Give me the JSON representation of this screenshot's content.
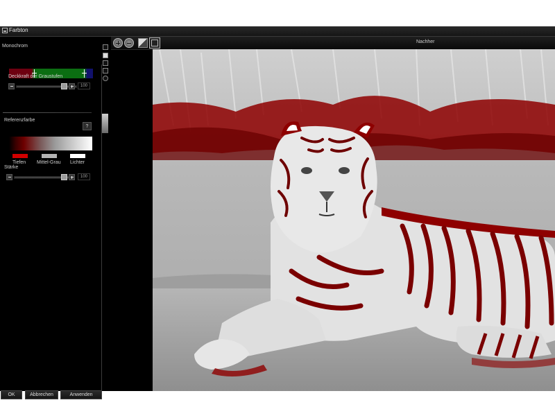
{
  "window": {
    "title": "Farbton"
  },
  "monochrom": {
    "section_label": "Monochrom",
    "opacity_label": "Deckkraft der Graustufen",
    "opacity_value": "100"
  },
  "reference": {
    "section_label": "Referenzfarbe",
    "help_label": "?",
    "swatches": [
      {
        "label": "Tiefen",
        "color": "#d00000"
      },
      {
        "label": "Mittel-Grau",
        "color": "#b4b4b4"
      },
      {
        "label": "Lichter",
        "color": "#ffffff"
      }
    ]
  },
  "strength": {
    "label": "Stärke",
    "value": "100"
  },
  "buttons": {
    "ok": "OK",
    "cancel": "Abbrechen",
    "apply": "Anwenden"
  },
  "viewer": {
    "label": "Nachher"
  },
  "colors": {
    "accent_red": "#8e0000",
    "panel_bg": "#000000"
  }
}
